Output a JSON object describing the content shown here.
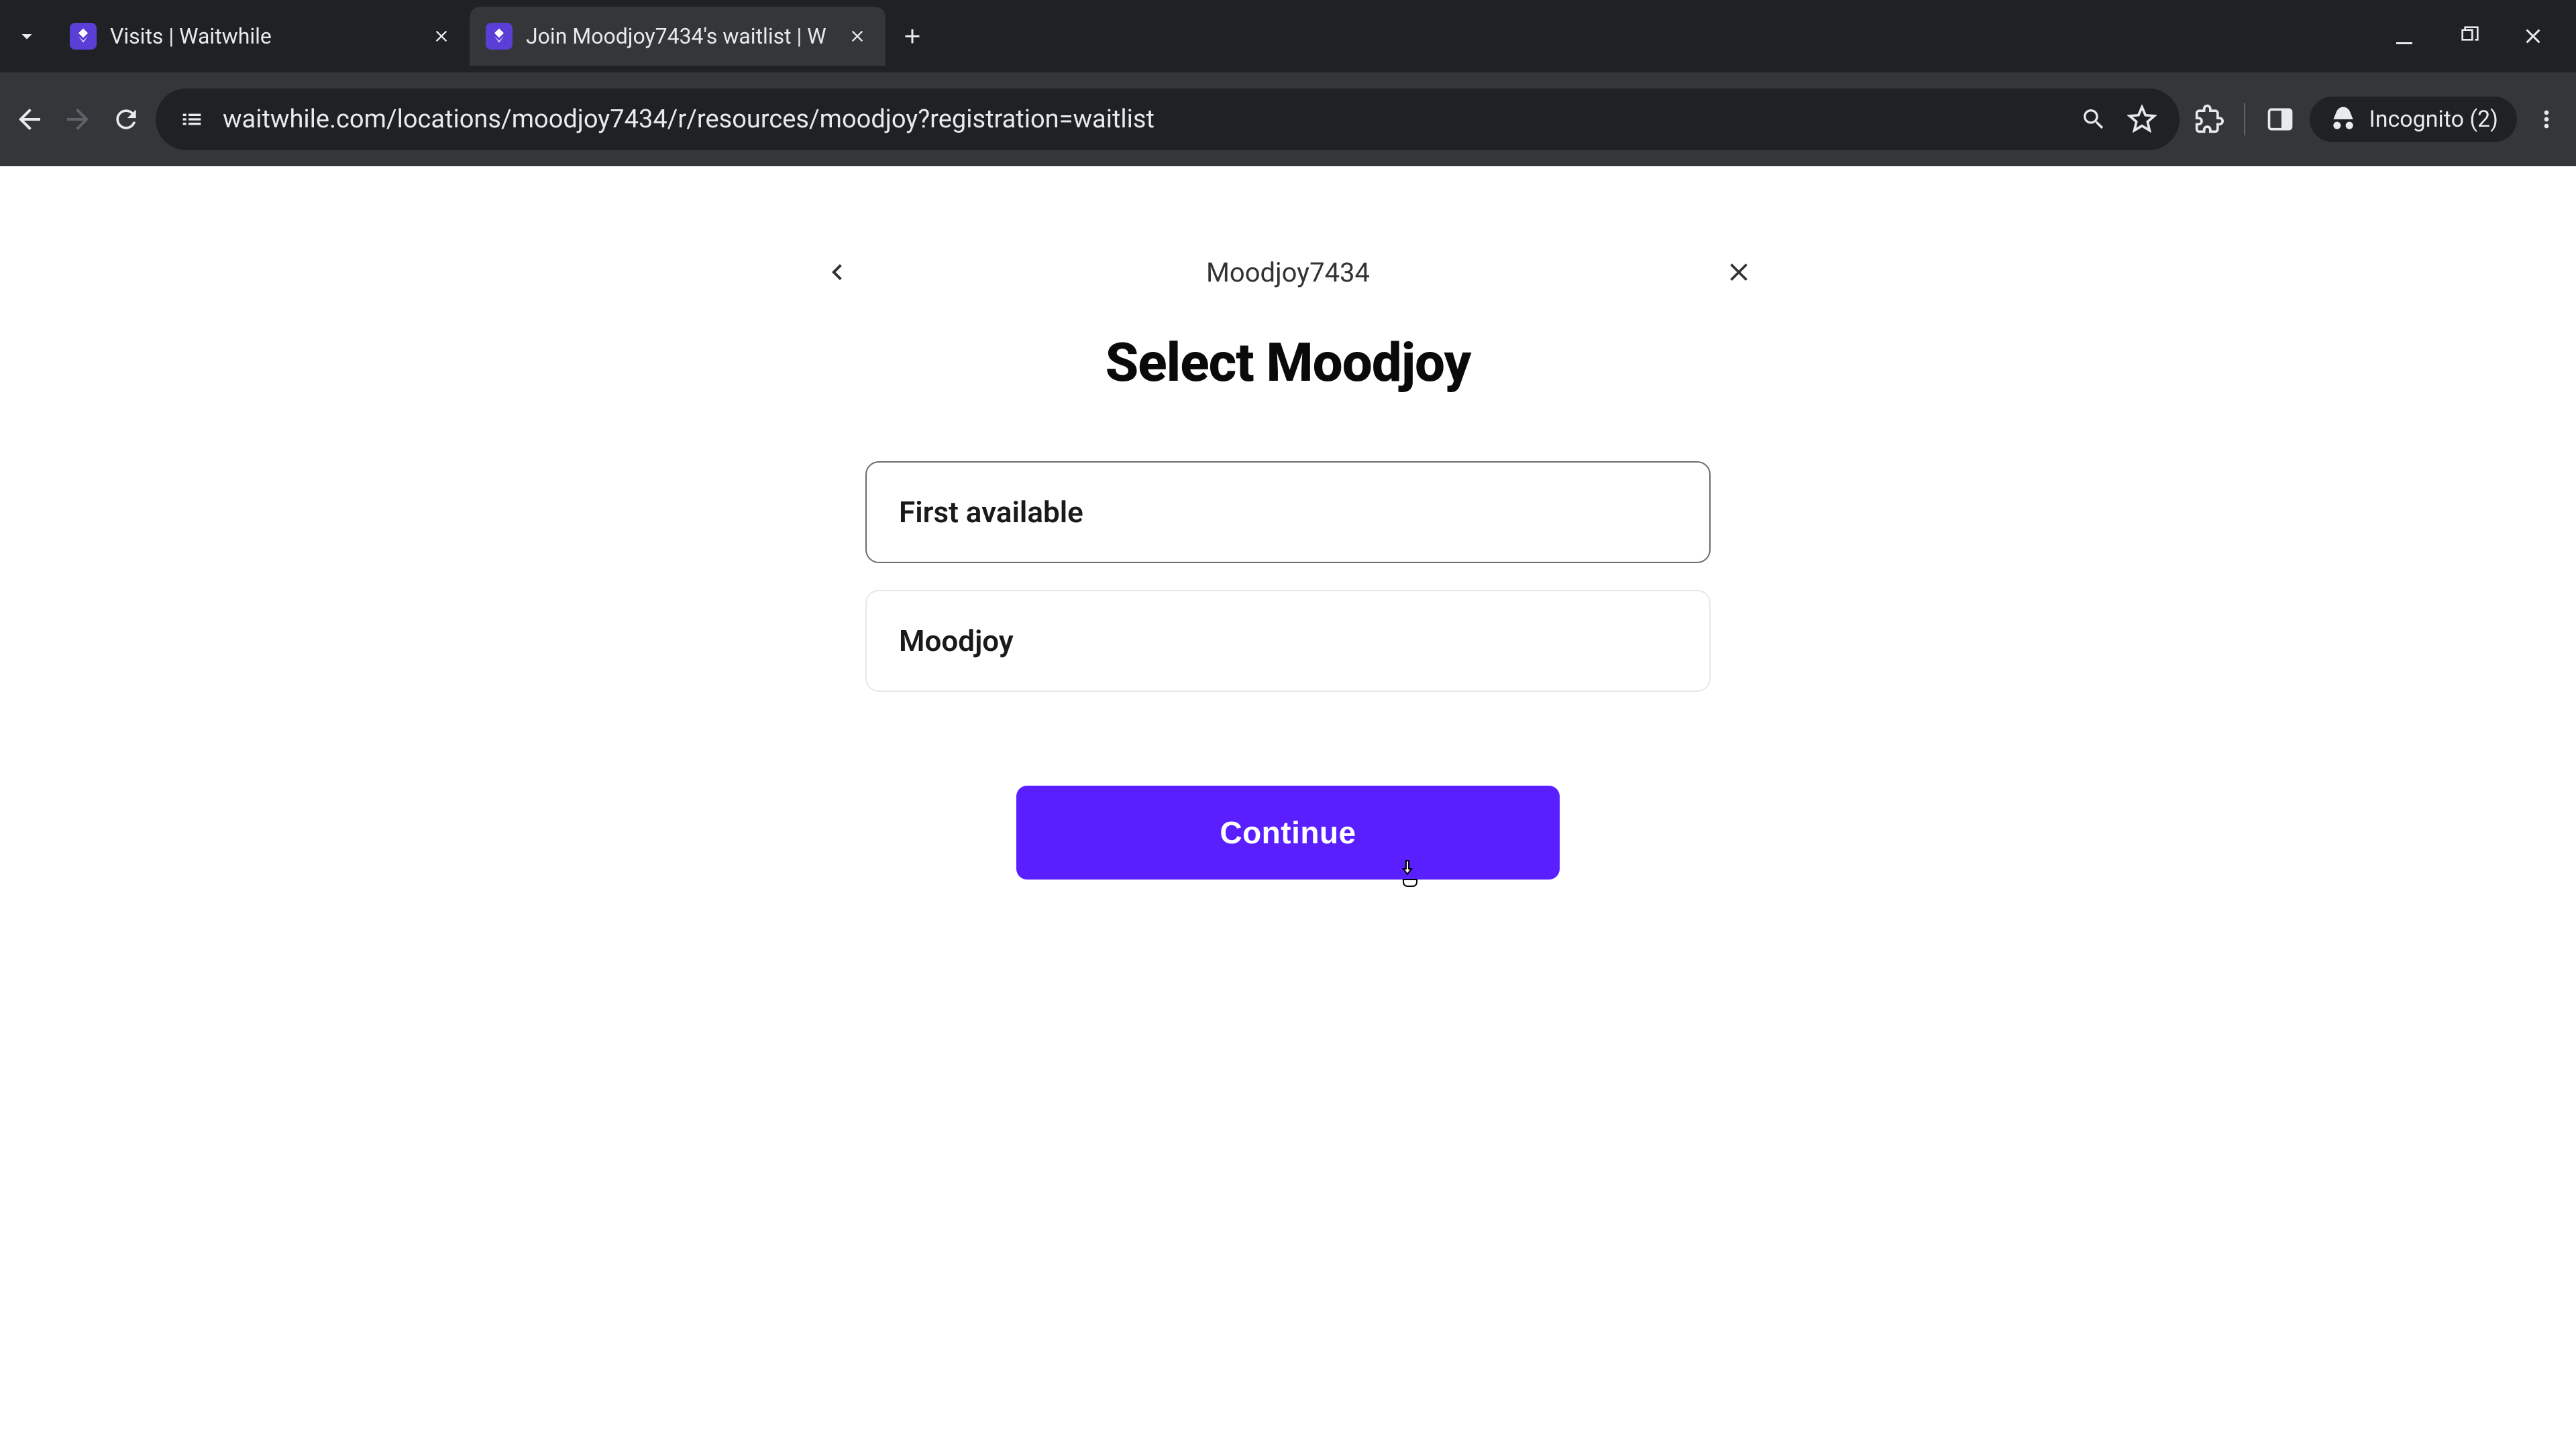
{
  "browser": {
    "tabs": [
      {
        "title": "Visits | Waitwhile",
        "active": false
      },
      {
        "title": "Join Moodjoy7434's waitlist | W",
        "active": true
      }
    ],
    "url": "waitwhile.com/locations/moodjoy7434/r/resources/moodjoy?registration=waitlist",
    "incognito_label": "Incognito (2)"
  },
  "page": {
    "breadcrumb_title": "Moodjoy7434",
    "heading": "Select Moodjoy",
    "options": [
      {
        "label": "First available",
        "selected": true
      },
      {
        "label": "Moodjoy",
        "selected": false
      }
    ],
    "continue_label": "Continue"
  }
}
